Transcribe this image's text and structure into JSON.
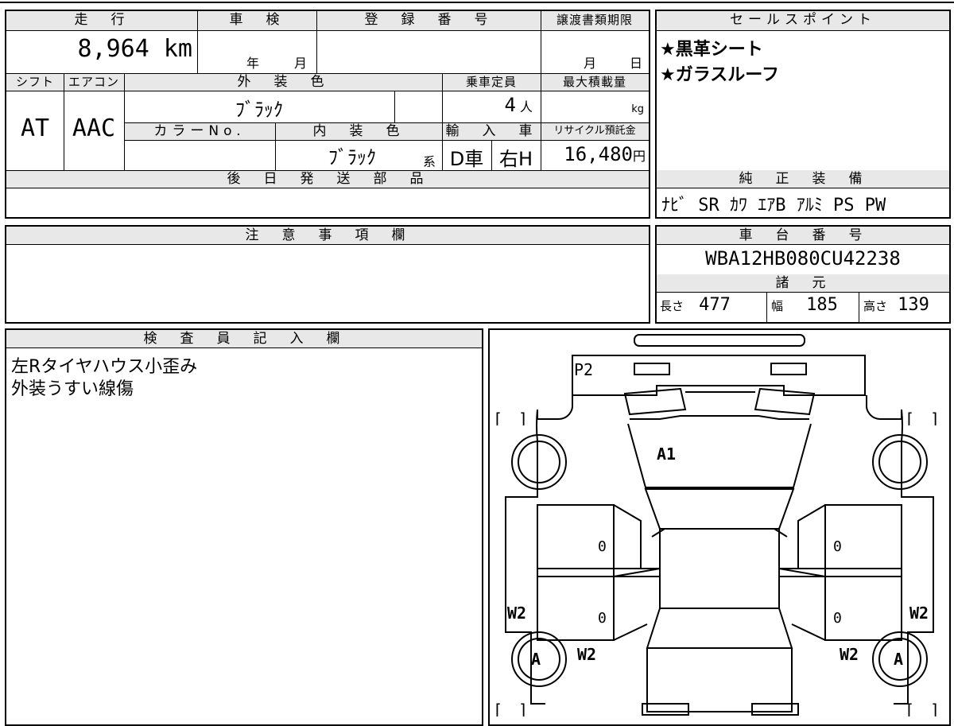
{
  "header": {
    "mileage_label": "走　行",
    "inspection_label": "車　検",
    "registration_label": "登　録　番　号",
    "transfer_deadline_label": "譲渡書類期限",
    "sales_points_label": "セールスポイント"
  },
  "mileage": {
    "value": "8,964",
    "unit": "km"
  },
  "inspection": {
    "year_label": "年",
    "month_label": "月"
  },
  "transfer_deadline": {
    "month_label": "月",
    "day_label": "日"
  },
  "row2_labels": {
    "shift": "シフト",
    "aircon": "エアコン",
    "exterior_color": "外　装　色",
    "capacity": "乗車定員",
    "max_load": "最大積載量"
  },
  "shift_value": "AT",
  "aircon_value": "AAC",
  "exterior_color_value": "ﾌﾞﾗｯｸ",
  "capacity": {
    "value": "4",
    "unit": "人"
  },
  "max_load": {
    "unit": "kg"
  },
  "row3_labels": {
    "color_no": "カラーNo.",
    "interior_color": "内　装　色",
    "import": "輸　入　車",
    "recycle": "リサイクル預託金"
  },
  "interior_color_value": "ﾌﾞﾗｯｸ",
  "interior_color_suffix": "系",
  "import_values": {
    "d_car": "D車",
    "right_h": "右H"
  },
  "recycle_fee": {
    "value": "16,480",
    "unit": "円"
  },
  "sales_points": [
    "★黒革シート",
    "★ガラスルーフ"
  ],
  "later_parts_label": "後　日　発　送　部　品",
  "genuine_equipment": {
    "label": "純　正　装　備",
    "value": "ﾅﾋﾞ SR ｶﾜ ｴｱB ｱﾙﾐ PS PW"
  },
  "notes_label": "注　意　事　項　欄",
  "chassis": {
    "label": "車　台　番　号",
    "value": "WBA12HB080CU42238"
  },
  "specs": {
    "label": "諸　元",
    "length_label": "長さ",
    "length_value": "477",
    "width_label": "幅",
    "width_value": "185",
    "height_label": "高さ",
    "height_value": "139"
  },
  "inspector": {
    "label": "検　査　員　記　入　欄",
    "lines": [
      "左Rタイヤハウス小歪み",
      "外装うすい線傷"
    ]
  },
  "diagram": {
    "marks": {
      "p2": "P2",
      "a1": "A1",
      "w2_left_outer": "W2",
      "w2_right_outer": "W2",
      "w2_left_inner": "W2",
      "w2_right_inner": "W2",
      "a_left": "A",
      "a_right": "A",
      "zero_1": "0",
      "zero_2": "0",
      "zero_3": "0",
      "zero_4": "0"
    },
    "brackets": "[　]"
  }
}
